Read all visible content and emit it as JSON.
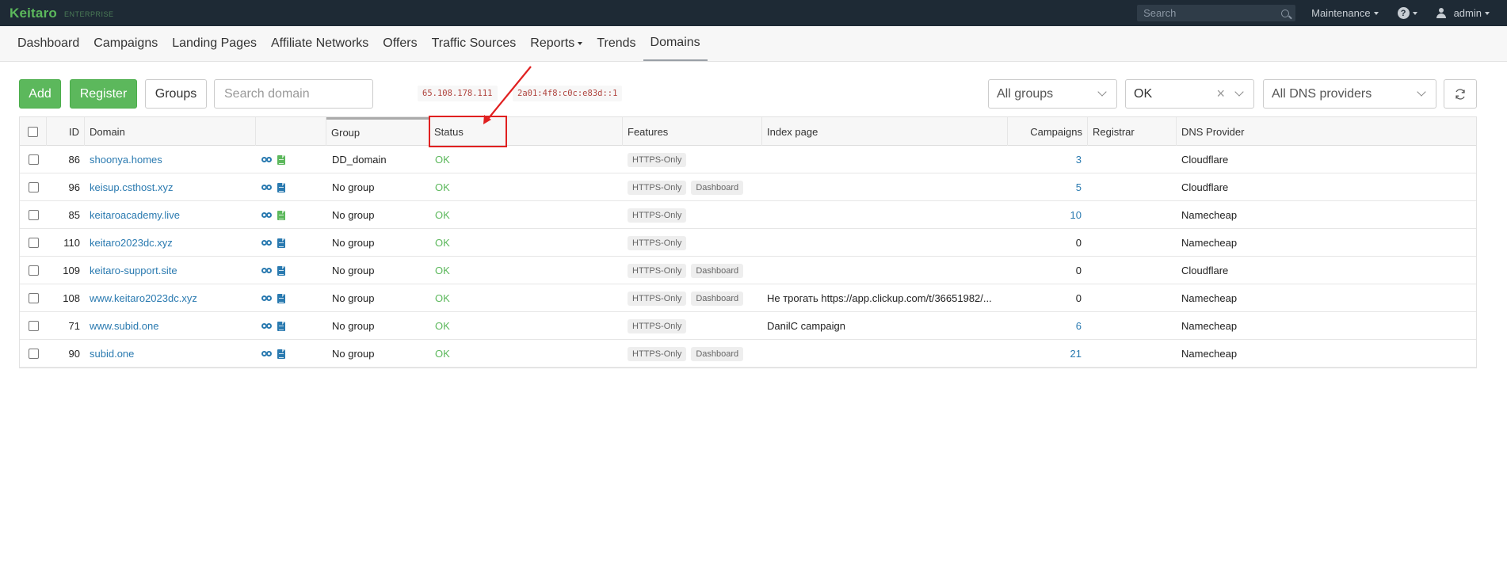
{
  "topbar": {
    "logo": "Keitaro",
    "edition": "ENTERPRISE",
    "search_placeholder": "Search",
    "maintenance": "Maintenance",
    "help": "?",
    "user": "admin"
  },
  "nav": {
    "items": [
      {
        "label": "Dashboard"
      },
      {
        "label": "Campaigns"
      },
      {
        "label": "Landing Pages"
      },
      {
        "label": "Affiliate Networks"
      },
      {
        "label": "Offers"
      },
      {
        "label": "Traffic Sources"
      },
      {
        "label": "Reports"
      },
      {
        "label": "Trends"
      },
      {
        "label": "Domains"
      }
    ],
    "active": "Domains"
  },
  "toolbar": {
    "add": "Add",
    "register": "Register",
    "groups": "Groups",
    "search_placeholder": "Search domain",
    "ip4": "65.108.178.111",
    "ip6": "2a01:4f8:c0c:e83d::1",
    "group_filter": "All groups",
    "status_filter": "OK",
    "dns_filter": "All DNS providers"
  },
  "table": {
    "columns": [
      "ID",
      "Domain",
      "Group",
      "Status",
      "Features",
      "Index page",
      "Campaigns",
      "Registrar",
      "DNS Provider"
    ],
    "rows": [
      {
        "id": "86",
        "domain": "shoonya.homes",
        "doc": "green",
        "group": "DD_domain",
        "status": "OK",
        "features": [
          "HTTPS-Only"
        ],
        "index": "",
        "campaigns": "3",
        "campaigns_link": true,
        "registrar": "",
        "dns": "Cloudflare"
      },
      {
        "id": "96",
        "domain": "keisup.csthost.xyz",
        "doc": "blue",
        "group": "No group",
        "status": "OK",
        "features": [
          "HTTPS-Only",
          "Dashboard"
        ],
        "index": "",
        "campaigns": "5",
        "campaigns_link": true,
        "registrar": "",
        "dns": "Cloudflare"
      },
      {
        "id": "85",
        "domain": "keitaroacademy.live",
        "doc": "green",
        "group": "No group",
        "status": "OK",
        "features": [
          "HTTPS-Only"
        ],
        "index": "",
        "campaigns": "10",
        "campaigns_link": true,
        "registrar": "",
        "dns": "Namecheap"
      },
      {
        "id": "110",
        "domain": "keitaro2023dc.xyz",
        "doc": "blue",
        "group": "No group",
        "status": "OK",
        "features": [
          "HTTPS-Only"
        ],
        "index": "",
        "campaigns": "0",
        "campaigns_link": false,
        "registrar": "",
        "dns": "Namecheap"
      },
      {
        "id": "109",
        "domain": "keitaro-support.site",
        "doc": "blue",
        "group": "No group",
        "status": "OK",
        "features": [
          "HTTPS-Only",
          "Dashboard"
        ],
        "index": "",
        "campaigns": "0",
        "campaigns_link": false,
        "registrar": "",
        "dns": "Cloudflare"
      },
      {
        "id": "108",
        "domain": "www.keitaro2023dc.xyz",
        "doc": "blue",
        "group": "No group",
        "status": "OK",
        "features": [
          "HTTPS-Only",
          "Dashboard"
        ],
        "index": "Не трогать https://app.clickup.com/t/36651982/...",
        "campaigns": "0",
        "campaigns_link": false,
        "registrar": "",
        "dns": "Namecheap"
      },
      {
        "id": "71",
        "domain": "www.subid.one",
        "doc": "blue",
        "group": "No group",
        "status": "OK",
        "features": [
          "HTTPS-Only"
        ],
        "index": "DanilC campaign",
        "campaigns": "6",
        "campaigns_link": true,
        "registrar": "",
        "dns": "Namecheap"
      },
      {
        "id": "90",
        "domain": "subid.one",
        "doc": "blue",
        "group": "No group",
        "status": "OK",
        "features": [
          "HTTPS-Only",
          "Dashboard"
        ],
        "index": "",
        "campaigns": "21",
        "campaigns_link": true,
        "registrar": "",
        "dns": "Namecheap"
      }
    ]
  },
  "colors": {
    "topbar_bg": "#1e2a35",
    "brand_green": "#5cb85c",
    "link_blue": "#2a7ab0",
    "annotation_red": "#e02020"
  }
}
